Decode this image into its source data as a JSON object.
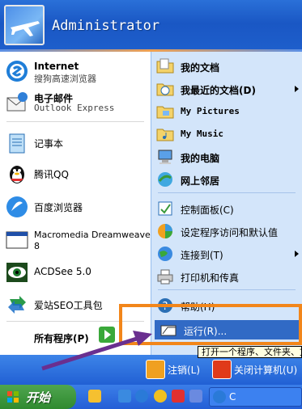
{
  "header": {
    "username": "Administrator"
  },
  "pinned": [
    {
      "title": "Internet",
      "subtitle": "搜狗高速浏览器"
    },
    {
      "title": "电子邮件",
      "subtitle": "Outlook Express"
    }
  ],
  "recent": [
    {
      "label": "记事本"
    },
    {
      "label": "腾讯QQ"
    },
    {
      "label": "百度浏览器"
    },
    {
      "label1": "Macromedia Dreamweaver",
      "label2": "8"
    },
    {
      "label": "ACDSee 5.0"
    },
    {
      "label": "爱站SEO工具包"
    }
  ],
  "all_programs": "所有程序(P)",
  "right": [
    {
      "label": "我的文档"
    },
    {
      "label": "我最近的文档(D)"
    },
    {
      "label": "My Pictures"
    },
    {
      "label": "My Music"
    },
    {
      "label": "我的电脑"
    },
    {
      "label": "网上邻居"
    },
    {
      "label": "控制面板(C)"
    },
    {
      "label": "设定程序访问和默认值"
    },
    {
      "label": "连接到(T)"
    },
    {
      "label": "打印机和传真"
    },
    {
      "label": "帮助(H)"
    },
    {
      "label": "运行(R)..."
    }
  ],
  "bottom": {
    "logoff": "注销(L)",
    "shutdown": "关闭计算机(U)"
  },
  "tooltip": "打开一个程序、文件夹、文档",
  "taskbar": {
    "start": "开始",
    "task": "C"
  },
  "colors": {
    "accent_orange": "#f2861a",
    "arrow_purple": "#6a2f8f",
    "highlight": "#316ac5"
  }
}
